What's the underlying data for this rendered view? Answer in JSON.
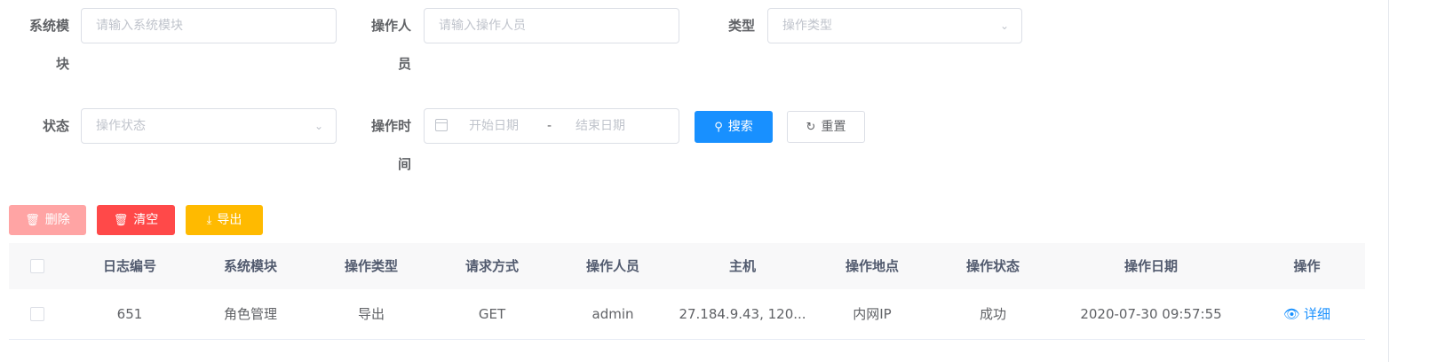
{
  "filters": {
    "module_label_line1": "系统模",
    "module_label_line2": "块",
    "module_placeholder": "请输入系统模块",
    "operator_label_line1": "操作人",
    "operator_label_line2": "员",
    "operator_placeholder": "请输入操作人员",
    "type_label": "类型",
    "type_placeholder": "操作类型",
    "status_label": "状态",
    "status_placeholder": "操作状态",
    "time_label_line1": "操作时",
    "time_label_line2": "间",
    "start_placeholder": "开始日期",
    "range_separator": "-",
    "end_placeholder": "结束日期",
    "search_label": "搜索",
    "reset_label": "重置"
  },
  "toolbar": {
    "delete_label": "删除",
    "clear_label": "清空",
    "export_label": "导出"
  },
  "table": {
    "headers": [
      "日志编号",
      "系统模块",
      "操作类型",
      "请求方式",
      "操作人员",
      "主机",
      "操作地点",
      "操作状态",
      "操作日期",
      "操作"
    ],
    "rows": [
      {
        "id": "651",
        "module": "角色管理",
        "type": "导出",
        "method": "GET",
        "operator": "admin",
        "host": "27.184.9.43, 120...",
        "location": "内网IP",
        "status": "成功",
        "date": "2020-07-30 09:57:55",
        "action": "详细"
      }
    ]
  },
  "colors": {
    "primary": "#1890ff",
    "danger": "#ff4949",
    "danger_light": "#ffa4a4",
    "warning": "#ffba00",
    "link": "#1890ff"
  }
}
